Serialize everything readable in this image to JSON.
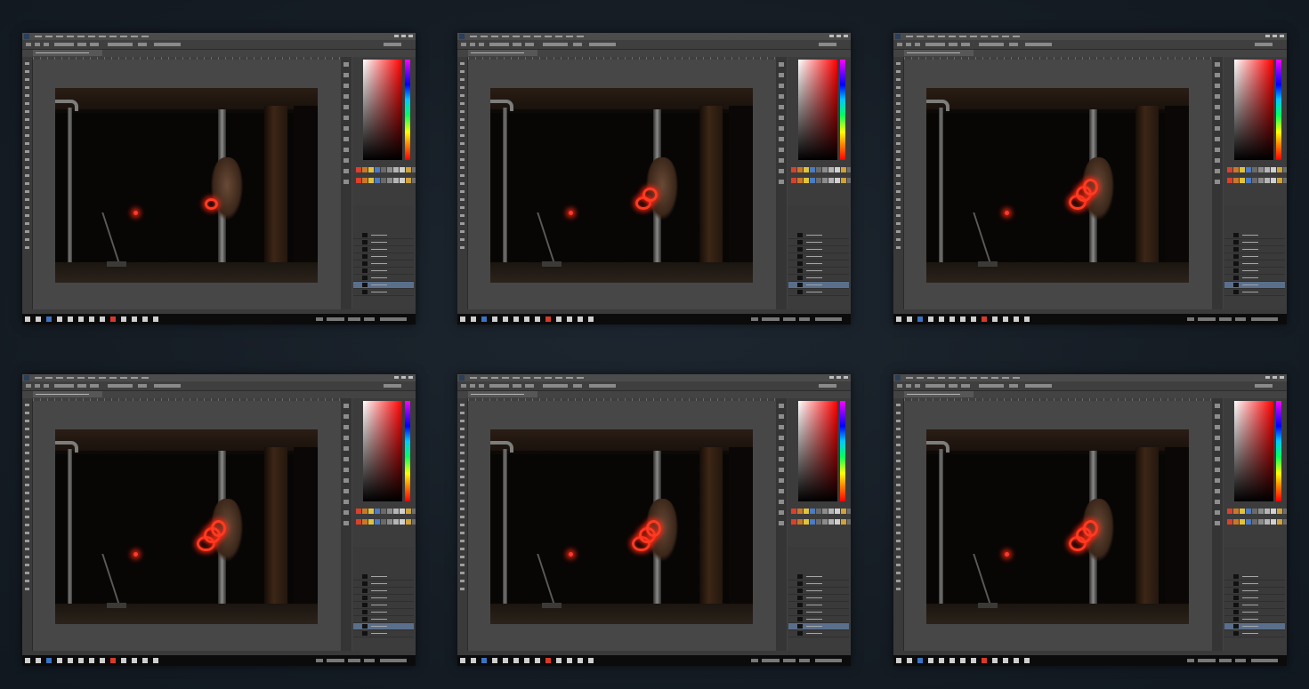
{
  "collage": {
    "frames": [
      {
        "trail_scale": 0.6
      },
      {
        "trail_scale": 0.85
      },
      {
        "trail_scale": 1.0
      },
      {
        "trail_scale": 1.05
      },
      {
        "trail_scale": 1.05
      },
      {
        "trail_scale": 1.0
      }
    ]
  },
  "colors": {
    "background": "#161d25",
    "app_chrome": "#434343",
    "glow": "#ff3b22",
    "selected_layer": "#5a6f8c"
  },
  "icons": {
    "app": "photoshop-icon",
    "taskbar": "windows-taskbar-icons"
  }
}
